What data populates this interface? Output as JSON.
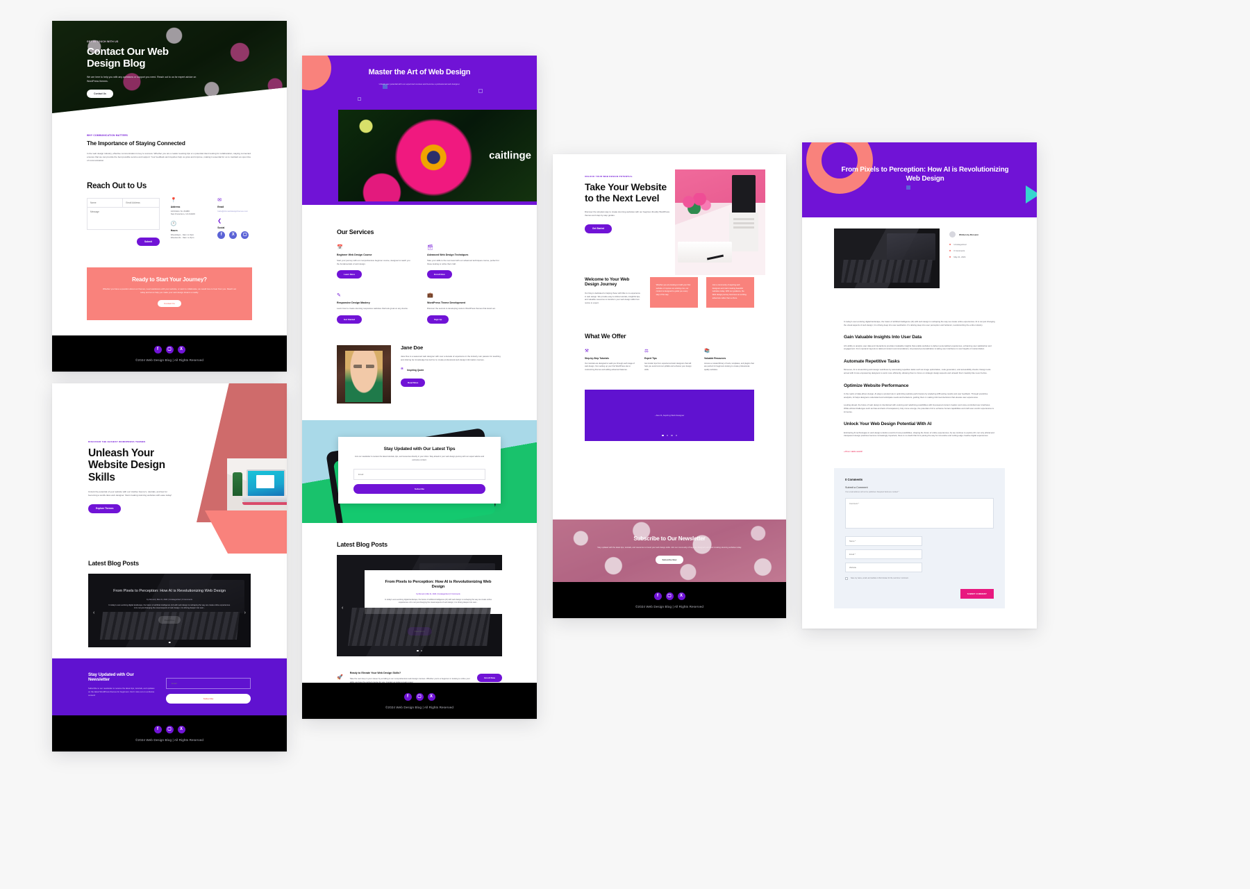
{
  "meta": {
    "background": "#f7f7f7",
    "accent": "#7013d6",
    "coral": "#f9827c",
    "dark": "#000000"
  },
  "contact_page": {
    "hero": {
      "eyebrow": "GET IN TOUCH WITH US",
      "title": "Contact Our Web Design Blog",
      "subtitle": "We are here to help you with any questions or support you need. Reach out to us for expert advice on WordPress themes.",
      "cta": "Contact Us"
    },
    "importance": {
      "eyebrow": "WHY COMMUNICATION MATTERS",
      "title": "The Importance of Staying Connected",
      "body": "In the web design industry, effective communication is key to success. Whether you are a reader seeking tips or a potential client looking for collaboration, staying connected ensures that we can provide the best possible service and support. Your feedback and inquiries help us grow and improve, making it essential for us to maintain an open line of communication."
    },
    "reach_out": {
      "title": "Reach Out to Us",
      "name_placeholder": "Name",
      "email_placeholder": "Email Address",
      "message_placeholder": "Message",
      "submit": "Submit",
      "address_label": "Address",
      "address_line1": "1234 Elm St. #1080",
      "address_line2": "San Francisco, CA 94109",
      "email_label": "Email",
      "email_value": "hello@divi.webdesignthemes.com",
      "hours_label": "Hours",
      "hours_line1": "Weekdays - 9am to 6pm",
      "hours_line2": "Weekends - 9am to 3pm",
      "social_label": "Social"
    },
    "journey": {
      "title": "Ready to Start Your Journey?",
      "body": "Whether you have a question about our themes, need assistance with your website, or want to collaborate, we would love to hear from you. Reach out today and let us help you make your web design dreams a reality.",
      "cta": "Contact Us"
    },
    "footer_copy": "©2024 Web Design Blog | All Rights Reserved"
  },
  "home_page": {
    "hero": {
      "eyebrow": "DISCOVER THE EASIEST WORDPRESS THEMES",
      "title": "Unleash Your Website Design Skills",
      "body": "Unlock the potential of your website with our intuitive how-to's, tutorials, and tips for becoming a world-class web designer. Start creating stunning websites with ease today!",
      "cta": "Explore Themes"
    },
    "blog": {
      "title": "Latest Blog Posts",
      "post_title": "From Pixels to Perception: How AI is Revolutionizing Web Design",
      "post_meta": "by Divi.ami | Mar 21, 2024 | Uncategorized | 0 Comments",
      "post_excerpt": "In today's ever-evolving digital landscape, the fusion of artificial intelligence (AI) with web design is reshaping the way we create online experiences. AI is not just changing the visual aspects of web design; it is driving deeper into user...",
      "post_cta": "Read More"
    },
    "newsletter": {
      "title": "Stay Updated with Our Newsletter",
      "body": "Subscribe to our newsletter to receive the latest tips, tutorials, and updates on the latest WordPress themes for beginners. Don't miss out on exclusive content!",
      "email_placeholder": "Email",
      "cta": "Subscribe"
    },
    "footer_copy": "©2024 Web Design Blog | All Rights Reserved"
  },
  "courses_page": {
    "hero": {
      "title": "Master the Art of Web Design",
      "subtitle": "Unlock your potential with our expert-led courses and become a professional web designer.",
      "image_word": "caitlinge"
    },
    "services": {
      "title": "Our Services",
      "items": [
        {
          "icon": "calendar-icon",
          "title": "Beginner Web Design Course",
          "body": "Start your journey with our comprehensive beginner course, designed to teach you the fundamentals of web design.",
          "cta": "Learn More"
        },
        {
          "icon": "layers-icon",
          "title": "Advanced Web Design Techniques",
          "body": "Take your skills to the next level with our advanced techniques course, perfect for those looking to refine their craft.",
          "cta": "Enroll Now"
        },
        {
          "icon": "pen-icon",
          "title": "Responsive Design Mastery",
          "body": "Learn how to create stunning responsive websites that look great on any device.",
          "cta": "Get Started"
        },
        {
          "icon": "toolbox-icon",
          "title": "WordPress Theme Development",
          "body": "Discover the secrets to developing custom WordPress themes that stand out.",
          "cta": "Sign Up"
        }
      ]
    },
    "author": {
      "name": "Jane Doe",
      "bio": "Jane Doe is a seasoned web designer with over a decade of experience in the industry. Her passion for teaching and sharing her knowledge has led her to create professional web design information courses.",
      "quote_label": "Inspiring Quote",
      "cta": "Read More"
    },
    "tips": {
      "title": "Stay Updated with Our Latest Tips",
      "body": "Join our newsletter to receive the latest tutorials, tips, and resources directly in your inbox. Stay ahead in your web design journey with our expert advice and exclusive content.",
      "email_placeholder": "Email",
      "cta": "Subscribe"
    },
    "blog": {
      "title": "Latest Blog Posts",
      "post_title": "From Pixels to Perception: How AI is Revolutionizing Web Design",
      "post_meta": "by Divi.ami | Mar 21, 2024 | Uncategorized | 0 Comments",
      "post_excerpt": "In today's ever-evolving digital landscape, the fusion of artificial intelligence (AI) with web design is reshaping the way we create online experiences. AI is not just changing the visual aspects of web design; it is driving deeper into user...",
      "post_cta": "Read More"
    },
    "elevate": {
      "title": "Ready to Elevate Your Web Design Skills?",
      "body": "Take the next step in your career by enrolling in our comprehensive web design courses. Whether you're a beginner or looking to refine your skills, we have the perfect course for you. Contact us today to learn more!",
      "cta": "Enroll Now"
    },
    "footer_copy": "©2024 Web Design Blog | All Rights Reserved"
  },
  "about_page": {
    "hero": {
      "eyebrow": "UNLOCK YOUR WEB DESIGN POTENTIAL",
      "title": "Take Your Website to the Next Level",
      "body": "Discover the simplest way to create stunning websites with our beginner-friendly WordPress themes and step-by-step guides.",
      "cta": "Get Started"
    },
    "welcome": {
      "title": "Welcome to Your Web Design Journey",
      "body": "Our blog is dedicated to helping those with little to no experience in web design. We provide easy-to-follow tutorials, insightful tips, and valuable resources to transform your web design skills from novice to expert.",
      "card1": "Whether you are looking to build your first website or improve an existing one, our content is designed to guide you every step of the way.",
      "card2": "Join a community of aspiring web designers and start creating beautiful websites today. With our guidance, the Web design journey becomes an exciting adventure rather than a chore."
    },
    "offer": {
      "title": "What We Offer",
      "items": [
        {
          "icon": "tutorial-icon",
          "title": "Step-by-Step Tutorials",
          "body": "Our tutorials are designed to walk you through each stage of web design, from setting up your first WordPress site to customizing themes and adding advanced features."
        },
        {
          "icon": "expert-icon",
          "title": "Expert Tips",
          "body": "Get insider tips from experienced web designers that will help you avoid common pitfalls and enhance your design skills."
        },
        {
          "icon": "resource-icon",
          "title": "Valuable Resources",
          "body": "Access a curated library of tools, templates, and plugins that are perfect for beginners looking to create professional-quality websites."
        }
      ]
    },
    "testimonial": {
      "attribution": "- Alex R, Aspiring Web Designer"
    },
    "subscribe": {
      "title": "Subscribe to Our Newsletter",
      "body": "Stay updated with the latest tips, tutorials, and resources to boost your web design skills. Join our community of beginner designers and start creating stunning websites today.",
      "cta": "Subscribe Now"
    },
    "footer_copy": "©2024 Web Design Blog | All Rights Reserved"
  },
  "blogpost_page": {
    "hero": {
      "title": "From Pixels to Perception: How AI is Revolutionizing Web Design"
    },
    "meta": {
      "written_by_label": "Written by Divi.ami",
      "category": "Uncategorized",
      "comments": "0 Comments",
      "date": "May 21, 2024"
    },
    "intro": "In today's ever-evolving digital landscape, the fusion of artificial intelligence (AI) with web design is reshaping the way we create online experiences. AI is not just changing the visual aspects of web design; it is driving deep into user aesthetics. It's delving deep into user perception and behavior, revolutionizing the entire industry.",
    "sections": [
      {
        "title": "Gain Valuable Insights Into User Data",
        "body": "AI's ability to analyze user data and interactions provides invaluable insights that enable websites to deliver personalized experiences, enhancing user satisfaction and engagement. From dynamic layouts to tailored content recommendations, AI-powered personalization is taking user interfaces to new heights of customization."
      },
      {
        "title": "Automate Repetitive Tasks",
        "body": "Moreover, AI is streamlining web design workflows by automating repetitive tasks such as image optimization, code generation, and accessibility checks. Design tools armed with AI are empowering designers to work more efficiently, allowing them to focus on strategic design aspects and unleash their creativity like never before."
      },
      {
        "title": "Optimize Website Performance",
        "body": "In the realm of data-driven design, AI plays a pivotal role in optimizing website performance by analyzing A/B testing results and user feedback. Through predictive analytics, AI helps designers understand and anticipate needs and behaviors, guiding them in making informed decisions that elevate user experiences."
      },
      {
        "title": "Unlock Your Web Design Potential With AI",
        "body": "Embracing AI technologies in web design unlocks a world of new possibilities, shaping the future of online experiences. As we continue to explore AI's not only ethical and transparent design practices become increasingly important, there is no doubt that AI is paving the way for innovative and cutting-edge creative digital experiences."
      }
    ],
    "extra_paragraph": "Looking ahead, the future of web design is intertwined with evolving and redefining possibilities with AI-powered content creation and voice-controlled user interfaces. While ethical challenges such as bias and lack of transparency truly come emerge, the potential of AI to enhance human capabilities and craft user-centric experiences is immense.",
    "prev_link": "« Prev: Hello world!",
    "comments": {
      "count_label": "0 Comments",
      "submit_title": "Submit a Comment",
      "note": "Your email address will not be published. Required fields are marked *",
      "comment_placeholder": "Comment *",
      "name_placeholder": "Name *",
      "email_placeholder": "Email *",
      "website_placeholder": "Website",
      "save_checkbox": "Save my name, email, and website in this browser for the next time I comment.",
      "submit_button": "SUBMIT COMMENT"
    }
  }
}
